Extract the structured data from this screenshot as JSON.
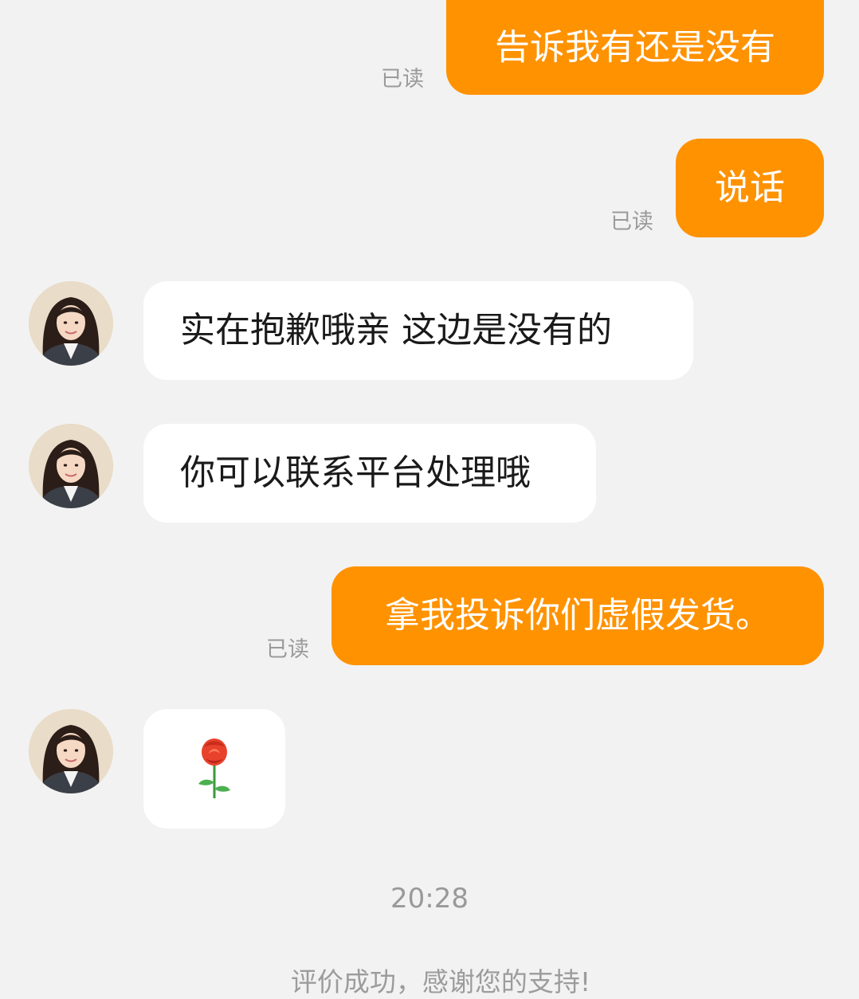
{
  "messages": [
    {
      "side": "sent",
      "text": "告诉我有还是没有",
      "status": "已读"
    },
    {
      "side": "sent",
      "text": "说话",
      "status": "已读"
    },
    {
      "side": "received",
      "text": "实在抱歉哦亲  这边是没有的"
    },
    {
      "side": "received",
      "text": "你可以联系平台处理哦"
    },
    {
      "side": "sent",
      "text": "拿我投诉你们虚假发货。",
      "status": "已读"
    },
    {
      "side": "received",
      "sticker": "rose-icon"
    }
  ],
  "timestamp": "20:28",
  "system_notice": "评价成功，感谢您的支持!",
  "colors": {
    "sent_bubble": "#ff9200",
    "received_bubble": "#ffffff",
    "background": "#f2f2f2"
  }
}
